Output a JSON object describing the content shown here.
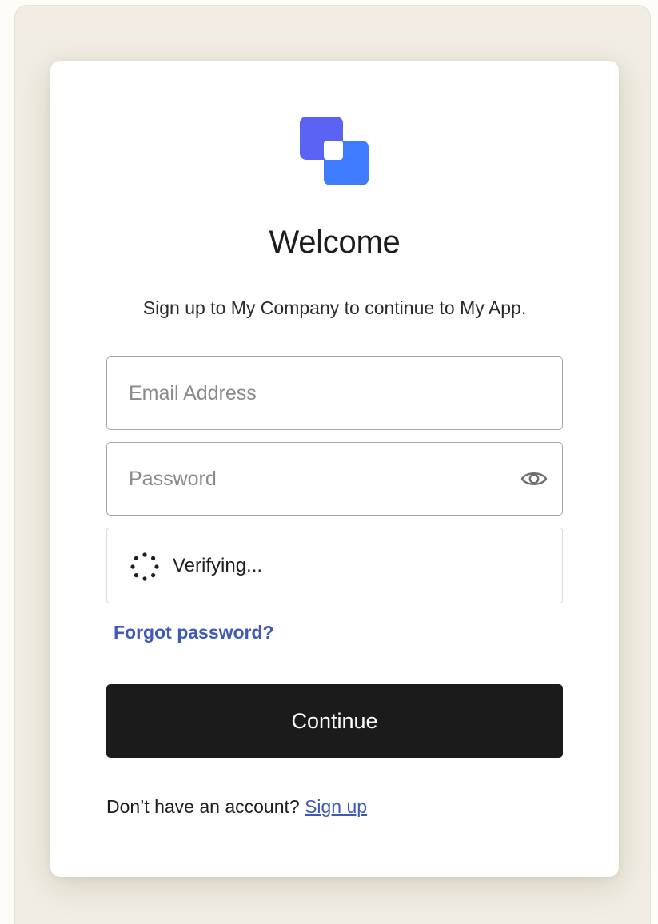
{
  "page": {
    "title": "Welcome",
    "subtitle": "Sign up to My Company to continue to My App."
  },
  "form": {
    "email": {
      "placeholder": "Email Address",
      "value": ""
    },
    "password": {
      "placeholder": "Password",
      "value": ""
    },
    "captcha": {
      "status_text": "Verifying..."
    },
    "forgot_password_label": "Forgot password?",
    "continue_label": "Continue"
  },
  "footer": {
    "prompt": "Don’t have an account?",
    "signup_label": "Sign up"
  },
  "icons": {
    "logo": "company-logo",
    "password_toggle": "eye-icon",
    "captcha_spinner": "spinner-icon"
  },
  "colors": {
    "logo_back": "#5b63f5",
    "logo_front": "#3f7bff",
    "link": "#3f59b8",
    "primary_button": "#1b1b1b",
    "background": "#f1ede3"
  }
}
